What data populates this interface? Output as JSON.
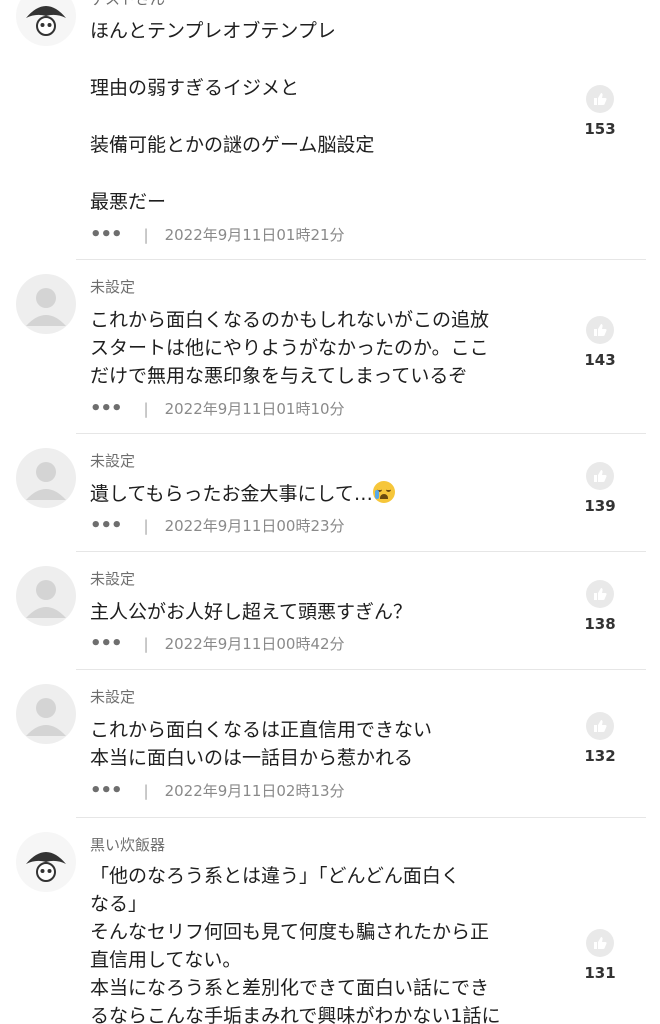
{
  "comments": [
    {
      "author": "ゲストさん",
      "avatar": "pirate",
      "lines": [
        "ほんとテンプレオブテンプレ",
        "理由の弱すぎるイジメと",
        "装備可能とかの謎のゲーム脳設定",
        "最悪だー"
      ],
      "more": "•••",
      "sep": "|",
      "date": "2022年9月11日01時21分",
      "likes": "153"
    },
    {
      "author": "未設定",
      "avatar": "default",
      "lines": [
        "これから面白くなるのかもしれないがこの追放",
        "スタートは他にやりようがなかったのか。ここ",
        "だけで無用な悪印象を与えてしまっているぞ"
      ],
      "more": "•••",
      "sep": "|",
      "date": "2022年9月11日01時10分",
      "likes": "143"
    },
    {
      "author": "未設定",
      "avatar": "default",
      "lines": [
        "遺してもらったお金大事にして…"
      ],
      "emoji": "crying-face-emoji",
      "more": "•••",
      "sep": "|",
      "date": "2022年9月11日00時23分",
      "likes": "139"
    },
    {
      "author": "未設定",
      "avatar": "default",
      "lines": [
        "主人公がお人好し超えて頭悪すぎん？"
      ],
      "more": "•••",
      "sep": "|",
      "date": "2022年9月11日00時42分",
      "likes": "138"
    },
    {
      "author": "未設定",
      "avatar": "default",
      "lines": [
        "これから面白くなるは正直信用できない",
        "本当に面白いのは一話目から惹かれる"
      ],
      "more": "•••",
      "sep": "|",
      "date": "2022年9月11日02時13分",
      "likes": "132"
    },
    {
      "author": "黒い炊飯器",
      "avatar": "pirate",
      "lines": [
        "「他のなろう系とは違う」「どんどん面白く",
        "なる」",
        "そんなセリフ何回も見て何度も騙されたから正",
        "直信用してない。",
        "本当になろう系と差別化できて面白い話にでき",
        "るならこんな手垢まみれで興味がわかない1話に"
      ],
      "likes": "131"
    }
  ],
  "icons": {
    "like": "thumbs-up-icon",
    "default_avatar": "user-silhouette-icon",
    "pirate_avatar": "pirate-skull-icon"
  },
  "colors": {
    "like_bg": "#e9e9e9",
    "divider": "#e6e6e6"
  }
}
